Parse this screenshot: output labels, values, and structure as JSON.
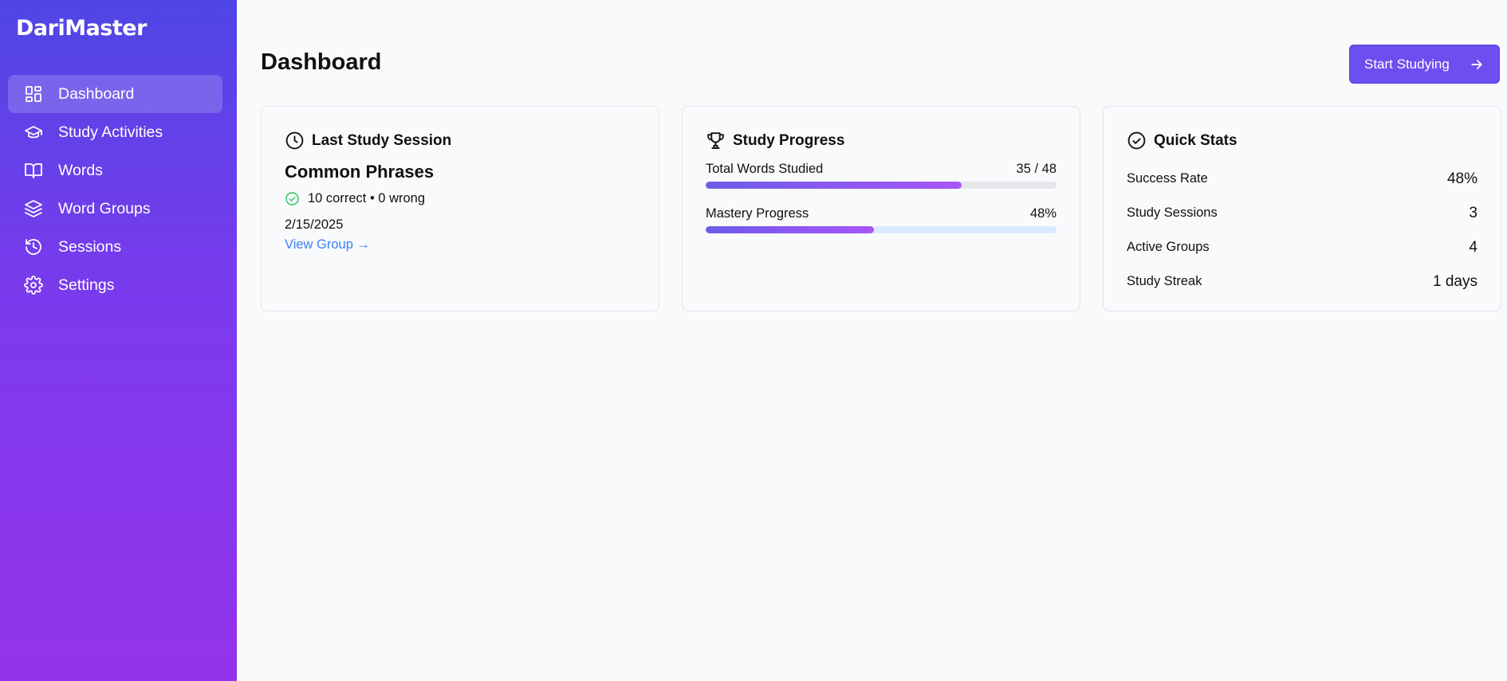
{
  "brand": "DariMaster",
  "nav": [
    {
      "label": "Dashboard",
      "icon": "dashboard-icon",
      "active": true
    },
    {
      "label": "Study Activities",
      "icon": "graduation-cap-icon",
      "active": false
    },
    {
      "label": "Words",
      "icon": "book-icon",
      "active": false
    },
    {
      "label": "Word Groups",
      "icon": "layers-icon",
      "active": false
    },
    {
      "label": "Sessions",
      "icon": "history-icon",
      "active": false
    },
    {
      "label": "Settings",
      "icon": "gear-icon",
      "active": false
    }
  ],
  "header": {
    "title": "Dashboard",
    "start_label": "Start Studying"
  },
  "last_session": {
    "title": "Last Study Session",
    "name": "Common Phrases",
    "result": "10 correct • 0 wrong",
    "date": "2/15/2025",
    "link": "View Group →"
  },
  "progress": {
    "title": "Study Progress",
    "total_label": "Total Words Studied",
    "total_value": "35 / 48",
    "total_fraction": 0.729,
    "mastery_label": "Mastery Progress",
    "mastery_value": "48%",
    "mastery_fraction": 0.48
  },
  "quick_stats": {
    "title": "Quick Stats",
    "rows": [
      {
        "label": "Success Rate",
        "value": "48%"
      },
      {
        "label": "Study Sessions",
        "value": "3"
      },
      {
        "label": "Active Groups",
        "value": "4"
      },
      {
        "label": "Study Streak",
        "value": "1 days"
      }
    ]
  }
}
